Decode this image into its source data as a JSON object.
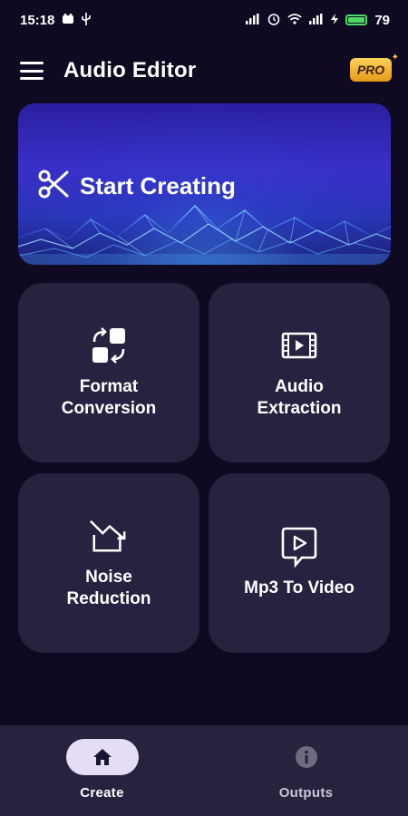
{
  "status_bar": {
    "time": "15:18",
    "battery_level": "79",
    "icons": [
      "notification-icon",
      "usb-icon",
      "alarm-icon",
      "wifi-icon",
      "signal-icon",
      "charging-icon",
      "battery-icon"
    ]
  },
  "app_bar": {
    "title": "Audio Editor",
    "pro_label": "PRO"
  },
  "banner": {
    "title": "Start Creating",
    "icon": "scissors-icon"
  },
  "tools": [
    {
      "label_line1": "Format",
      "label_line2": "Conversion",
      "icon": "format-conversion-icon"
    },
    {
      "label_line1": "Audio",
      "label_line2": "Extraction",
      "icon": "video-film-icon"
    },
    {
      "label_line1": "Noise",
      "label_line2": "Reduction",
      "icon": "noise-reduction-icon"
    },
    {
      "label_line1": "Mp3 To Video",
      "label_line2": "",
      "icon": "play-bubble-icon"
    }
  ],
  "bottom_nav": {
    "create_label": "Create",
    "outputs_label": "Outputs"
  },
  "colors": {
    "background": "#0f0a22",
    "card": "#26223f",
    "nav_bar": "#27233f",
    "active_pill": "#e5dcf7",
    "pro_badge": "#f2b53a",
    "battery": "#4cd964"
  }
}
